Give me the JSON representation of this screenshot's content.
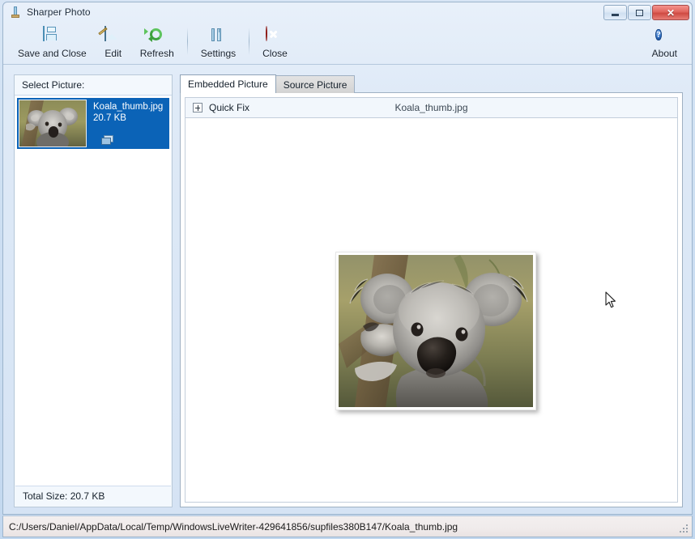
{
  "window": {
    "title": "Sharper Photo",
    "icon": "app-tool-icon",
    "controls": {
      "minimize": "minimize-button",
      "maximize": "maximize-button",
      "close": "close-button",
      "close_glyph": "✕"
    }
  },
  "toolbar": {
    "buttons": [
      {
        "label": "Save and Close",
        "icon": "save-icon"
      },
      {
        "label": "Edit",
        "icon": "edit-picture-icon"
      },
      {
        "label": "Refresh",
        "icon": "refresh-icon"
      },
      {
        "label": "Settings",
        "icon": "settings-tools-icon"
      },
      {
        "label": "Close",
        "icon": "close-circle-icon"
      }
    ],
    "about": {
      "label": "About",
      "icon": "about-info-icon",
      "glyph": "?"
    }
  },
  "left_panel": {
    "header": "Select Picture:",
    "items": [
      {
        "name": "Koala_thumb.jpg",
        "size": "20.7 KB",
        "selected": true,
        "badge_icon": "embedded-picture-icon"
      }
    ],
    "footer": "Total Size: 20.7 KB"
  },
  "tabs": [
    {
      "label": "Embedded Picture",
      "active": true
    },
    {
      "label": "Source Picture",
      "active": false
    }
  ],
  "quick_fix": {
    "expander_icon": "plus-expander-icon",
    "label": "Quick Fix",
    "filename": "Koala_thumb.jpg"
  },
  "preview": {
    "image_alt": "Koala photograph"
  },
  "status_bar": {
    "path": "C:/Users/Daniel/AppData/Local/Temp/WindowsLiveWriter-429641856/supfiles380B147/Koala_thumb.jpg",
    "grip_icon": "resize-grip-icon"
  },
  "colors": {
    "selection_blue": "#0b63b7",
    "accent_close_red": "#cc2f28",
    "refresh_green": "#3da13d",
    "about_blue": "#2f6fc4",
    "window_chrome": "#d5e3f4"
  }
}
